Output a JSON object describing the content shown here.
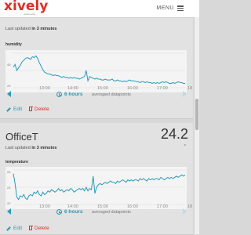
{
  "header": {
    "logo": "xively",
    "logo_sub": "powered by",
    "menu_label": "MENU",
    "menu_icon": "hamburger-icon"
  },
  "cards": [
    {
      "updated_prefix": "Last updated ",
      "updated_value": "in 3 minutes",
      "channel": "humidity",
      "yticks": [
        "40",
        "20"
      ],
      "x_labels": [
        "13:00",
        "14:00",
        "15:00",
        "16:00",
        "17:00",
        "18"
      ],
      "duration": "6 hours",
      "averaged": "averaged datapoints",
      "edit": "Edit",
      "delete": "Delete",
      "series": [
        34,
        37,
        30,
        33,
        36,
        40,
        42,
        44,
        45,
        44,
        43,
        46,
        45,
        47,
        44,
        39,
        35,
        31,
        28,
        27,
        26,
        26,
        25,
        24,
        25,
        24,
        24,
        23,
        22,
        23,
        22,
        22,
        21,
        22,
        21,
        22,
        21,
        21,
        20,
        21,
        22,
        23,
        30,
        18,
        23,
        22,
        21,
        20,
        21,
        20,
        20,
        19,
        19,
        20,
        19,
        19,
        19,
        20,
        18,
        18,
        19,
        18,
        18,
        17,
        18,
        17,
        18,
        19,
        18,
        18,
        18,
        17,
        17,
        16,
        17,
        17,
        16,
        17,
        16,
        16,
        15,
        16,
        15,
        16,
        15,
        16,
        17,
        16,
        17,
        16,
        15,
        15,
        16,
        15,
        16,
        17,
        16,
        16,
        15,
        15
      ]
    },
    {
      "device_name": "OfficeT",
      "value": "24.2",
      "unit": "c",
      "updated_prefix": "Last updated ",
      "updated_value": "in 3 minutes",
      "channel": "temperature",
      "yticks": [
        "24",
        "23",
        "22"
      ],
      "x_labels": [
        "13:00",
        "14:00",
        "15:00",
        "16:00",
        "17:00",
        "18"
      ],
      "duration": "6 hours",
      "averaged": "averaged datapoints",
      "edit": "Edit",
      "delete": "Delete",
      "series": [
        24.3,
        23.5,
        22.4,
        22.2,
        22.5,
        22.4,
        22.6,
        22.3,
        22.2,
        22.5,
        22.6,
        22.5,
        22.8,
        22.7,
        22.9,
        22.6,
        22.5,
        22.8,
        22.6,
        22.7,
        22.9,
        22.8,
        23.0,
        22.9,
        22.8,
        22.9,
        23.1,
        22.9,
        23.0,
        22.8,
        22.9,
        23.0,
        22.9,
        23.1,
        23.0,
        22.8,
        22.9,
        23.0,
        23.1,
        23.0,
        23.1,
        22.9,
        23.2,
        22.9,
        23.1,
        23.0,
        24.1,
        22.7,
        23.2,
        23.4,
        23.5,
        23.4,
        23.5,
        23.6,
        23.5,
        23.6,
        23.7,
        23.6,
        23.6,
        23.5,
        23.7,
        23.6,
        23.7,
        23.8,
        23.7,
        23.6,
        23.8,
        23.7,
        23.8,
        23.7,
        23.8,
        23.8,
        23.7,
        23.9,
        23.8,
        23.9,
        23.8,
        23.7,
        23.9,
        23.8,
        23.9,
        23.8,
        23.9,
        23.9,
        23.8,
        24.0,
        23.9,
        23.8,
        23.9,
        24.0,
        23.9,
        24.0,
        23.9,
        24.0,
        24.1,
        24.0,
        24.1,
        24.2,
        24.1,
        24.2
      ]
    }
  ],
  "colors": {
    "accent": "#2a9ab8",
    "danger": "#d9302b",
    "logo": "#d9302b"
  }
}
